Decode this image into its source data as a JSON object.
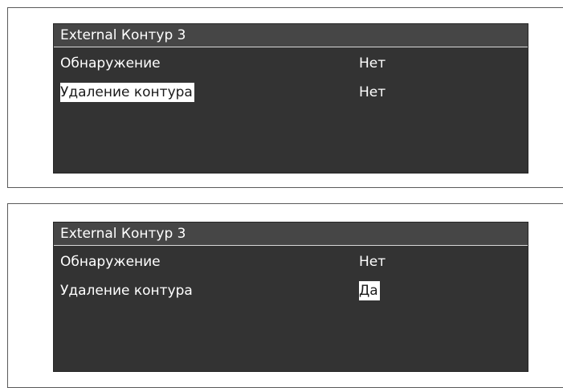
{
  "panels": [
    {
      "title": "External Контур 3",
      "rows": [
        {
          "label": "Обнаружение",
          "value": "Нет"
        },
        {
          "label": "Удаление контура",
          "value": "Нет"
        }
      ]
    },
    {
      "title": "External Контур 3",
      "rows": [
        {
          "label": "Обнаружение",
          "value": "Нет"
        },
        {
          "label": "Удаление контура",
          "value": "Да"
        }
      ]
    }
  ],
  "colors": {
    "screen_background": "#333333",
    "title_background": "#464646",
    "text": "#ffffff",
    "selection_background": "#ffffff",
    "selection_text": "#1a1a1a"
  }
}
